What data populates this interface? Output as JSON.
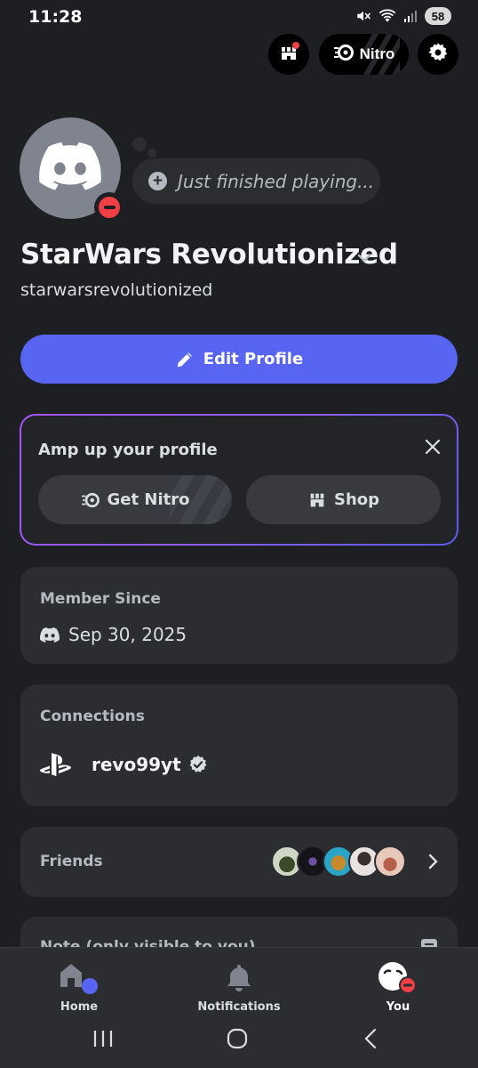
{
  "status_bar": {
    "time": "11:28",
    "battery": "58",
    "icons": [
      "mute-icon",
      "wifi-icon",
      "signal-icon",
      "battery-icon"
    ]
  },
  "top_actions": {
    "nitro_label": "Nitro"
  },
  "profile": {
    "status_text": "Just finished playing...",
    "display_name": "StarWars Revolutionized",
    "username": "starwarsrevolutionized",
    "presence": "do-not-disturb"
  },
  "edit_button": {
    "label": "Edit Profile"
  },
  "amp_card": {
    "title": "Amp up your profile",
    "get_nitro_label": "Get Nitro",
    "shop_label": "Shop"
  },
  "member_since": {
    "label": "Member Since",
    "date": "Sep 30, 2025"
  },
  "connections": {
    "label": "Connections",
    "items": [
      {
        "platform": "playstation",
        "name": "revo99yt",
        "verified": true
      }
    ]
  },
  "friends": {
    "label": "Friends",
    "avatar_count": 5
  },
  "note": {
    "label": "Note (only visible to you)"
  },
  "bottom_nav": {
    "items": [
      {
        "label": "Home",
        "active": false
      },
      {
        "label": "Notifications",
        "active": false
      },
      {
        "label": "You",
        "active": true
      }
    ]
  },
  "colors": {
    "accent": "#5865f2",
    "dnd": "#f23f43",
    "card": "#2b2d31",
    "background": "#1e1f22"
  }
}
